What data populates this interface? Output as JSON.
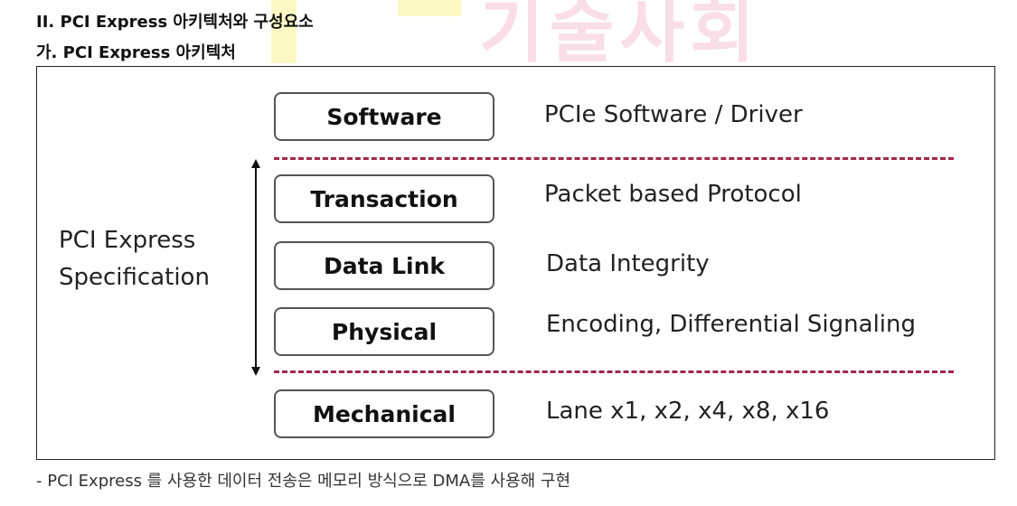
{
  "watermark": {
    "text": "기술사회"
  },
  "headings": {
    "section": "II. PCI Express 아키텍처와 구성요소",
    "subsection": "가. PCI Express 아키텍처"
  },
  "diagram": {
    "spec_label_line1": "PCI Express",
    "spec_label_line2": "Specification",
    "layers": [
      {
        "name": "Software",
        "desc": "PCIe Software / Driver"
      },
      {
        "name": "Transaction",
        "desc": "Packet based Protocol"
      },
      {
        "name": "Data Link",
        "desc": "Data Integrity"
      },
      {
        "name": "Physical",
        "desc": "Encoding, Differential Signaling"
      },
      {
        "name": "Mechanical",
        "desc": "Lane x1, x2, x4, x8, x16"
      }
    ],
    "colors": {
      "dash": "#a0284a",
      "box_border": "#555555"
    }
  },
  "footer": {
    "note": "- PCI Express 를 사용한 데이터 전송은 메모리 방식으로 DMA를 사용해 구현"
  }
}
